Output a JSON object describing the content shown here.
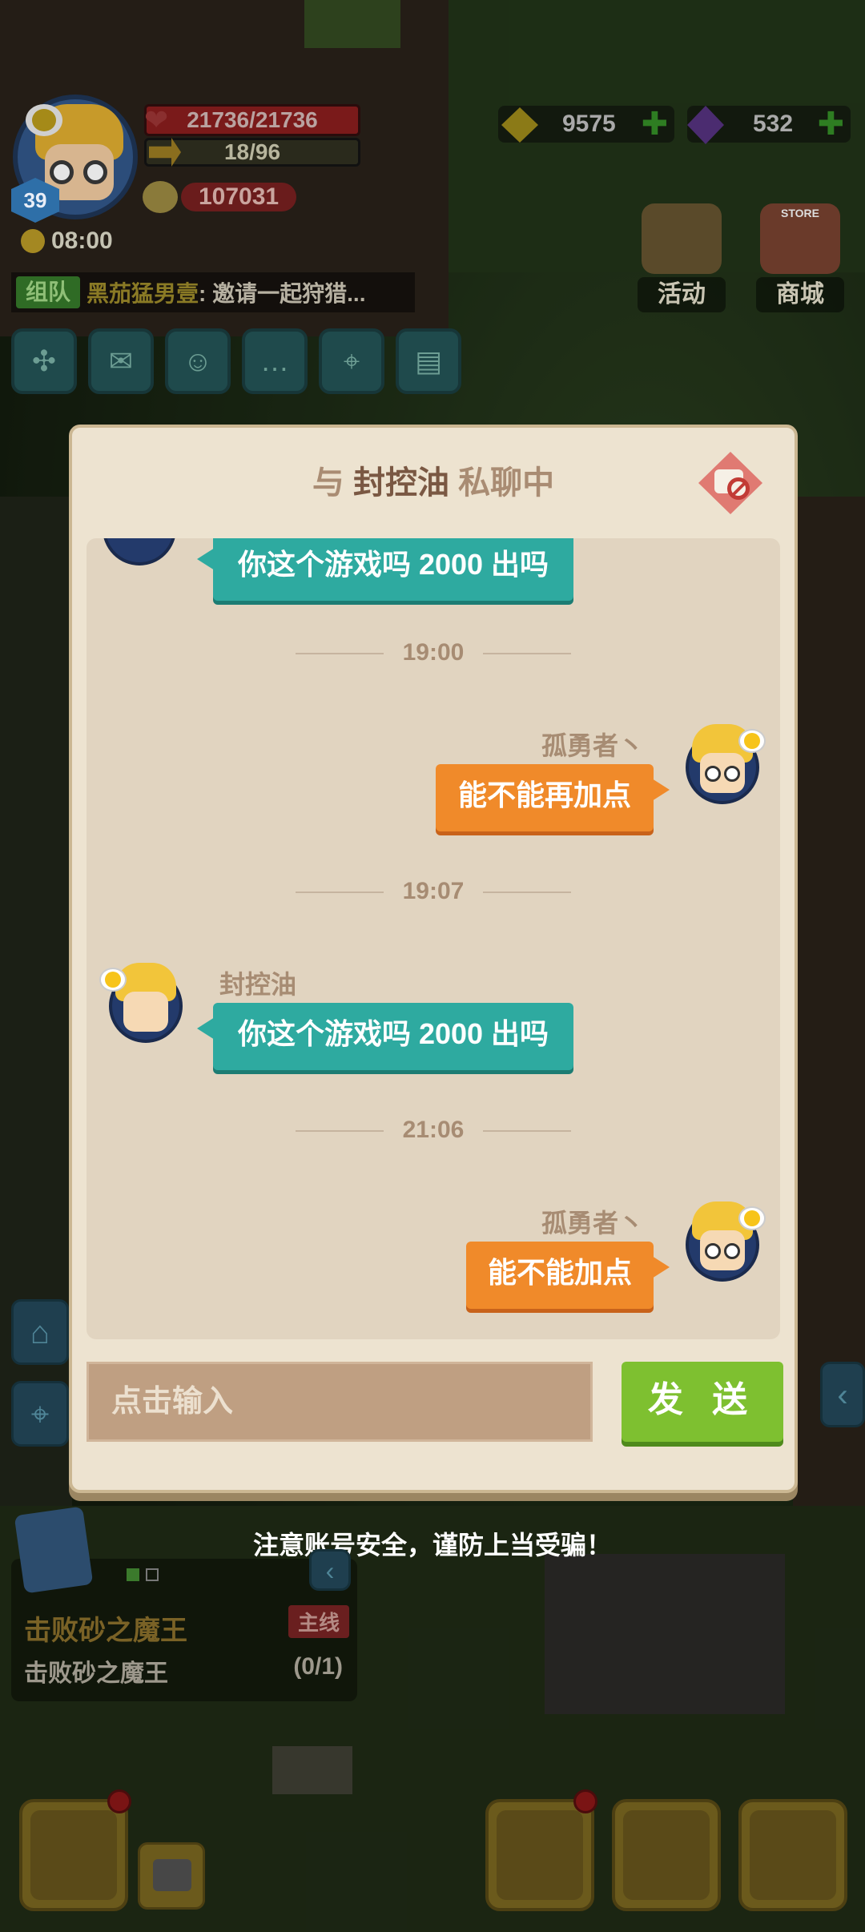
{
  "hud": {
    "level": "39",
    "hp": "21736/21736",
    "energy": "18/96",
    "power": "107031",
    "time": "08:00",
    "gold": "9575",
    "diamonds": "532",
    "activity_label": "活动",
    "shop_label": "商城",
    "store_sign": "STORE",
    "team_tag": "组队",
    "team_sender": "黑茄猛男壹",
    "team_message": ": 邀请一起狩猎...",
    "quick_icons": [
      "expand-icon",
      "mail-icon",
      "friends-icon",
      "chat-icon",
      "map-icon",
      "notice-icon"
    ]
  },
  "dialog": {
    "title_prefix": "与",
    "title_name": "封控油",
    "title_suffix": "私聊中",
    "partial_message": "你这个游戏吗 2000 出吗",
    "messages": [
      {
        "time": "19:00",
        "sender": "孤勇者丶",
        "side": "right",
        "text": "能不能再加点",
        "color": "#f08a2a"
      },
      {
        "time": "19:07",
        "sender": "封控油",
        "side": "left",
        "text": "你这个游戏吗 2000 出吗",
        "color": "#2eaaa0"
      },
      {
        "time": "21:06",
        "sender": "孤勇者丶",
        "side": "right",
        "text": "能不能加点",
        "color": "#f08a2a"
      }
    ],
    "input_placeholder": "点击输入",
    "send_label": "发 送"
  },
  "warning": "注意账号安全，谨防上当受骗！",
  "quest": {
    "title": "击败砂之魔王",
    "tag": "主线",
    "description": "击败砂之魔王",
    "progress": "(0/1)"
  },
  "colors": {
    "dialog_bg": "#ede3d0",
    "chat_bg": "#e1d4c0",
    "send_button": "#7ec030",
    "own_bubble": "#f08a2a",
    "other_bubble": "#2eaaa0"
  }
}
